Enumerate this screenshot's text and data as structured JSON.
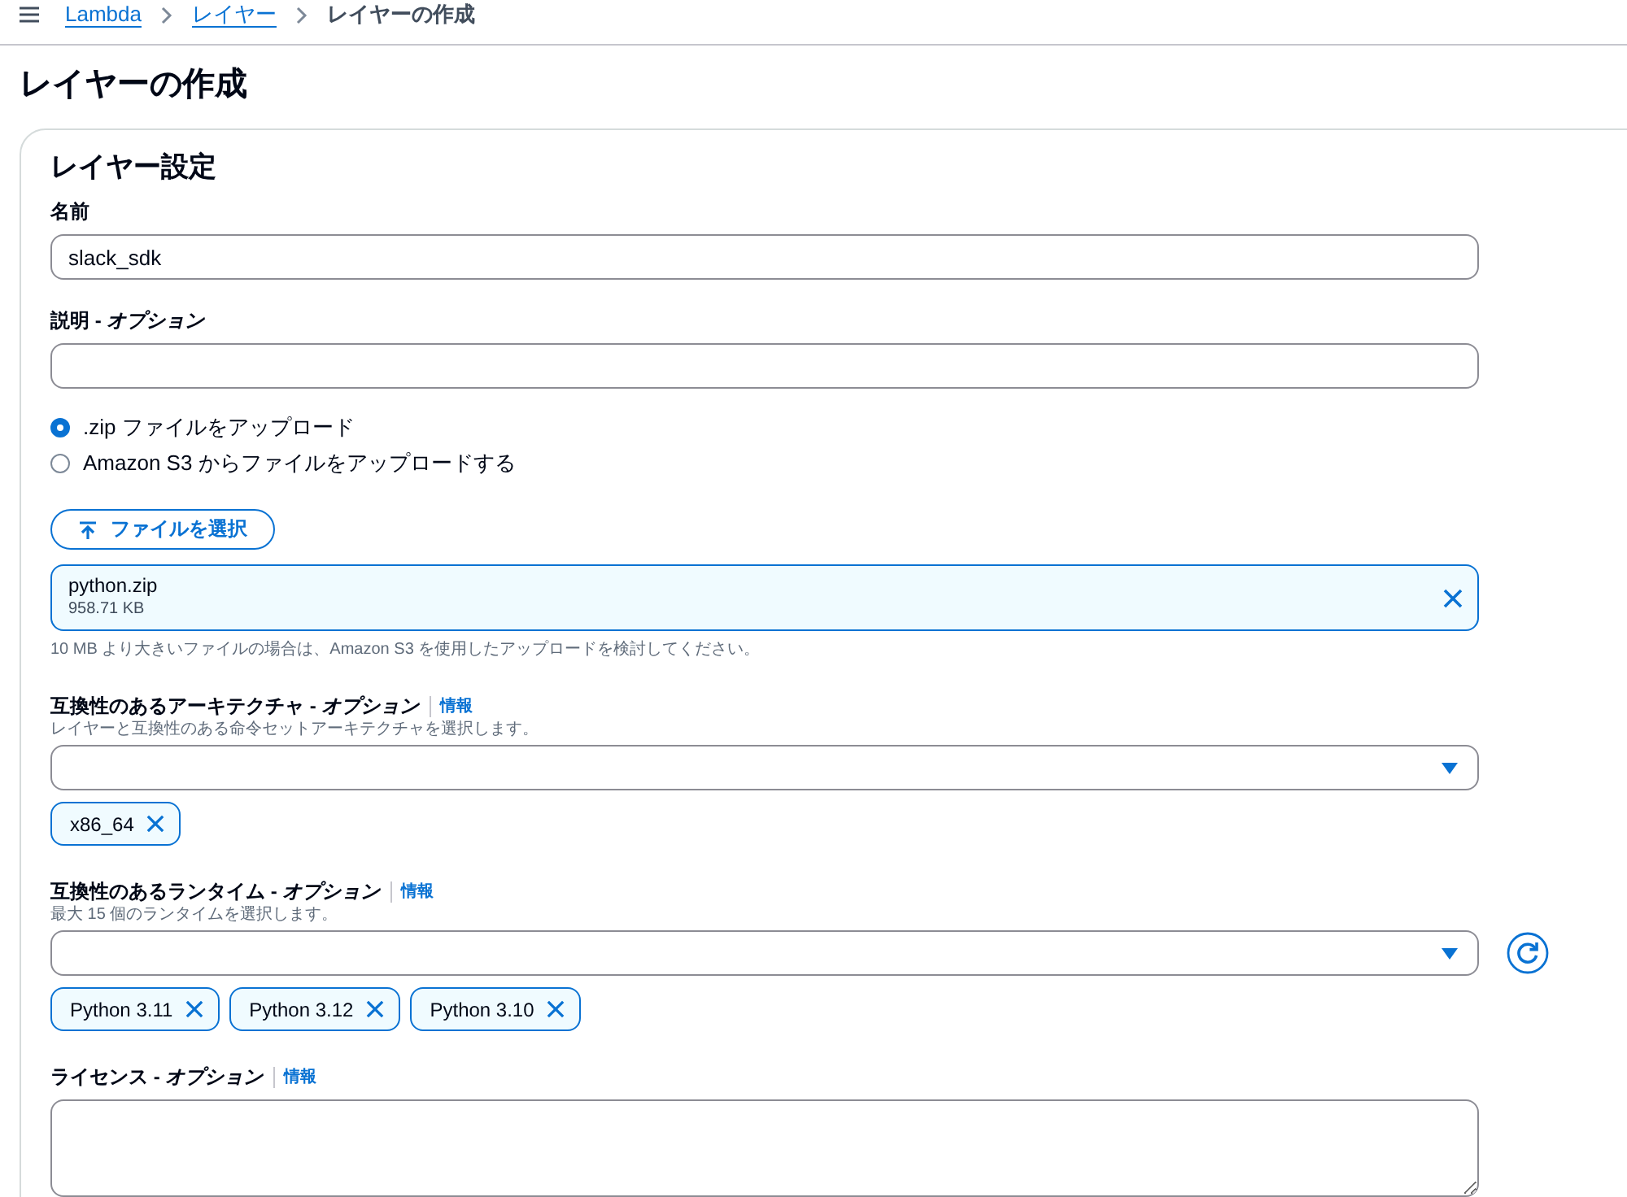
{
  "breadcrumbs": [
    {
      "label": "Lambda",
      "link": true
    },
    {
      "label": "レイヤー",
      "link": true
    },
    {
      "label": "レイヤーの作成",
      "link": false
    }
  ],
  "page_title": "レイヤーの作成",
  "section_title": "レイヤー設定",
  "name_field": {
    "label": "名前",
    "value": "slack_sdk"
  },
  "description_field": {
    "label": "説明 - *オプション*"
  },
  "upload_options": [
    {
      "label": ".zip ファイルをアップロード",
      "selected": true
    },
    {
      "label": "Amazon S3 からファイルをアップロードする",
      "selected": false
    }
  ],
  "choose_file_button": "ファイルを選択",
  "file": {
    "name": "python.zip",
    "size": "958.71 KB"
  },
  "file_hint": "10 MB より大きいファイルの場合は、Amazon S3 を使用したアップロードを検討してください。",
  "architectures": {
    "label": "互換性のあるアーキテクチャ - *オプション*",
    "info": "情報",
    "description": "レイヤーと互換性のある命令セットアーキテクチャを選択します。",
    "tokens": [
      "x86_64"
    ],
    "refresh": false
  },
  "runtimes": {
    "label": "互換性のあるランタイム - *オプション*",
    "info": "情報",
    "description": "最大 15 個のランタイムを選択します。",
    "tokens": [
      "Python 3.11",
      "Python 3.12",
      "Python 3.10"
    ],
    "refresh": true
  },
  "license_field": {
    "label": "ライセンス - *オプション*",
    "info": "情報"
  }
}
